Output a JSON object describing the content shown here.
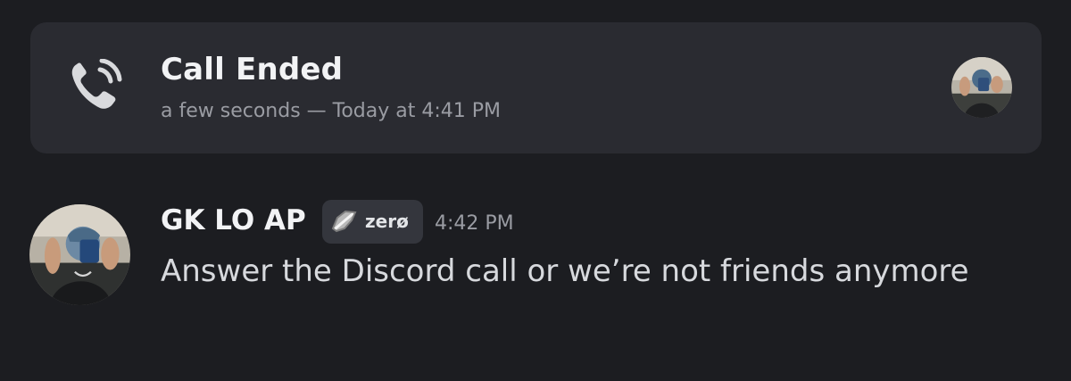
{
  "call_event": {
    "title": "Call Ended",
    "meta": "a few seconds — Today at 4:41 PM",
    "icon": "phone-call-icon"
  },
  "message": {
    "author": "GK LO AP",
    "tag_label": "zerø",
    "tag_icon": "leaf-icon",
    "time": "4:42 PM",
    "text": "Answer the Discord call or we’re not friends anymore"
  },
  "colors": {
    "background": "#1c1d21",
    "card": "#2a2b31",
    "primary_text": "#f2f3f5",
    "secondary_text": "#9a9ca3",
    "message_text": "#d7d9dd",
    "tag_bg": "#34363d"
  }
}
